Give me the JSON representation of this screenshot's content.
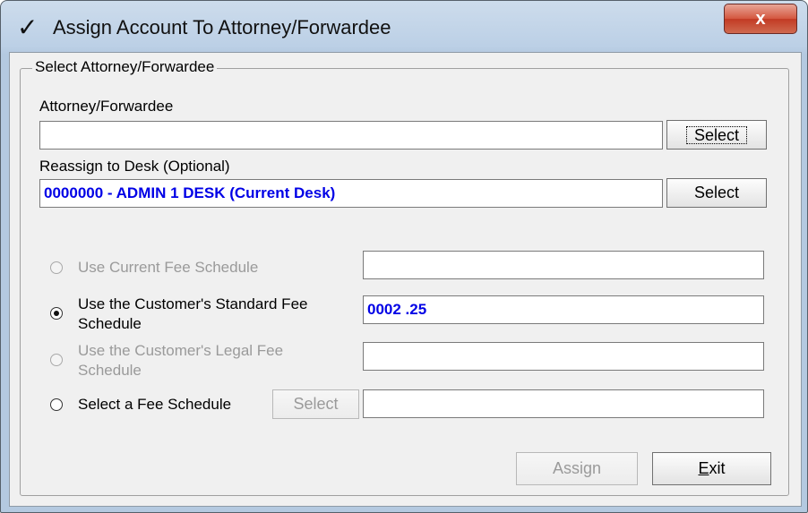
{
  "window": {
    "title": "Assign Account To Attorney/Forwardee",
    "title_icon": "checkmark-icon",
    "close_glyph": "x"
  },
  "group": {
    "legend": "Select Attorney/Forwardee"
  },
  "attorney": {
    "label": "Attorney/Forwardee",
    "value": "",
    "select_label": "Select"
  },
  "desk": {
    "label": "Reassign to Desk (Optional)",
    "value": "0000000 - ADMIN 1 DESK (Current Desk)",
    "select_label": "Select"
  },
  "fee_options": [
    {
      "label": "Use Current Fee Schedule",
      "selected": false,
      "enabled": false,
      "value": ""
    },
    {
      "label": "Use the Customer's Standard Fee Schedule",
      "selected": true,
      "enabled": true,
      "value": "0002 .25"
    },
    {
      "label": "Use the Customer's Legal Fee Schedule",
      "selected": false,
      "enabled": false,
      "value": ""
    },
    {
      "label": "Select a Fee Schedule",
      "selected": false,
      "enabled": true,
      "value": "",
      "select_label": "Select"
    }
  ],
  "footer": {
    "assign_label": "Assign",
    "exit_label_first": "E",
    "exit_label_rest": "xit"
  }
}
